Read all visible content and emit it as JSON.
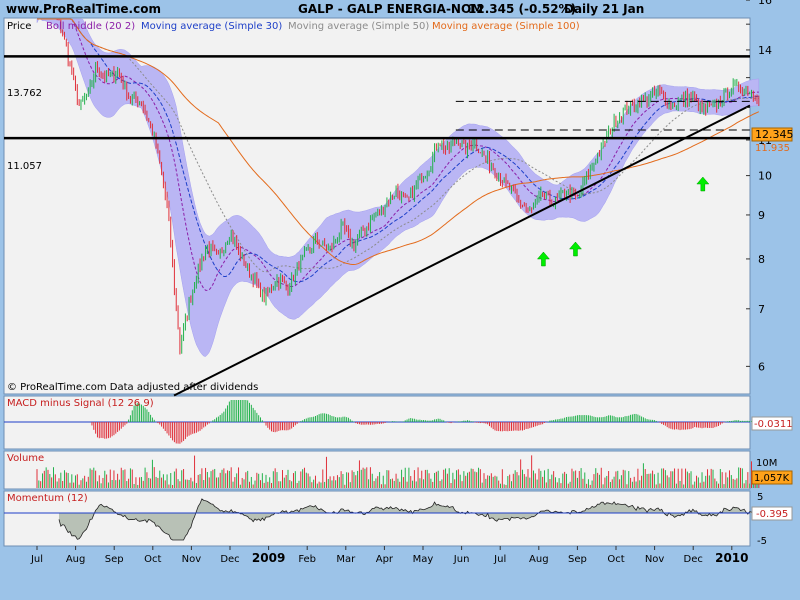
{
  "header": {
    "site": "www.ProRealTime.com",
    "instrument": "GALP - GALP ENERGIA-NOM",
    "quote": "12.345 (-0.52%)",
    "period": "Daily  21 Jan"
  },
  "price_panel": {
    "title": "Price",
    "legend": [
      {
        "label": "Boll middle (20 2)",
        "color": "#8b1fa8"
      },
      {
        "label": "Moving average (Simple 30)",
        "color": "#1d3fc8"
      },
      {
        "label": "Moving average (Simple 50)",
        "color": "#8c8c8c"
      },
      {
        "label": "Moving average (Simple 100)",
        "color": "#e36b1c"
      }
    ],
    "hline_labels": [
      "13.762",
      "11.057"
    ],
    "last_price": "12.345",
    "ma_value": "11.935",
    "footer": "© ProRealTime.com  Data adjusted after dividends"
  },
  "macd_panel": {
    "title": "MACD minus Signal (12 26 9)",
    "last_value": "-0.0311"
  },
  "volume_panel": {
    "title": "Volume",
    "top_tick": "10M",
    "last_value": "1,057K"
  },
  "momentum_panel": {
    "title": "Momentum (12)",
    "last_value": "-0.395",
    "ticks": [
      "5",
      "0",
      "-5"
    ]
  },
  "colors": {
    "background": "#9cc3e8",
    "panel": "#f2f2f2",
    "bollinger_band": "#bab6f4",
    "up_candle": "#22b14c",
    "down_candle": "#e0303a",
    "arrow": "#00ee00",
    "price_box": "#ffa21a"
  },
  "chart_data": {
    "type": "candlestick",
    "title": "GALP - GALP ENERGIA-NOM",
    "x_months": [
      "Jul",
      "Aug",
      "Sep",
      "Oct",
      "Nov",
      "Dec",
      "2009",
      "Feb",
      "Mar",
      "Apr",
      "May",
      "Jun",
      "Jul",
      "Aug",
      "Sep",
      "Oct",
      "Nov",
      "Dec",
      "2010"
    ],
    "y_ticks": [
      6,
      7,
      8,
      9,
      10,
      11,
      12,
      13,
      14,
      15,
      16
    ],
    "y_tick_labels": [
      "6",
      "7",
      "8",
      "9",
      "10",
      "11",
      "",
      "",
      "14",
      "",
      "16"
    ],
    "ylim": [
      5.6,
      16.4
    ],
    "horizontal_lines": [
      13.762,
      11.057
    ],
    "dashed_lines": [
      11.3,
      12.2
    ],
    "trendline": {
      "from": {
        "month": 3.55,
        "price": 5.55
      },
      "to": {
        "month": 19.0,
        "price": 12.0
      }
    },
    "arrows": [
      {
        "month": 13.12
      },
      {
        "month": 13.95
      },
      {
        "month": 17.25
      }
    ],
    "close_path": [
      [
        0.0,
        16.2
      ],
      [
        0.35,
        15.9
      ],
      [
        0.65,
        14.7
      ],
      [
        0.9,
        13.2
      ],
      [
        1.1,
        12.0
      ],
      [
        1.35,
        12.5
      ],
      [
        1.55,
        13.4
      ],
      [
        1.8,
        13.0
      ],
      [
        2.1,
        13.2
      ],
      [
        2.4,
        12.3
      ],
      [
        2.7,
        12.2
      ],
      [
        3.0,
        11.2
      ],
      [
        3.2,
        10.2
      ],
      [
        3.4,
        9.0
      ],
      [
        3.55,
        7.5
      ],
      [
        3.7,
        6.3
      ],
      [
        3.85,
        6.8
      ],
      [
        4.1,
        7.6
      ],
      [
        4.4,
        8.3
      ],
      [
        4.7,
        8.0
      ],
      [
        5.0,
        8.6
      ],
      [
        5.3,
        8.0
      ],
      [
        5.6,
        7.6
      ],
      [
        5.9,
        7.2
      ],
      [
        6.2,
        7.6
      ],
      [
        6.5,
        7.4
      ],
      [
        6.8,
        7.9
      ],
      [
        7.2,
        8.4
      ],
      [
        7.6,
        8.2
      ],
      [
        7.9,
        8.7
      ],
      [
        8.2,
        8.3
      ],
      [
        8.5,
        8.7
      ],
      [
        8.9,
        9.1
      ],
      [
        9.3,
        9.6
      ],
      [
        9.6,
        9.3
      ],
      [
        9.9,
        9.9
      ],
      [
        10.2,
        10.3
      ],
      [
        10.4,
        11.0
      ],
      [
        10.6,
        10.7
      ],
      [
        10.9,
        11.0
      ],
      [
        11.1,
        10.7
      ],
      [
        11.3,
        11.0
      ],
      [
        11.6,
        10.5
      ],
      [
        11.9,
        10.1
      ],
      [
        12.2,
        9.7
      ],
      [
        12.5,
        9.3
      ],
      [
        12.8,
        9.1
      ],
      [
        13.1,
        9.5
      ],
      [
        13.4,
        9.3
      ],
      [
        13.7,
        9.6
      ],
      [
        14.0,
        9.4
      ],
      [
        14.3,
        10.1
      ],
      [
        14.6,
        10.7
      ],
      [
        14.9,
        11.4
      ],
      [
        15.2,
        11.9
      ],
      [
        15.5,
        12.1
      ],
      [
        15.8,
        12.3
      ],
      [
        16.1,
        12.5
      ],
      [
        16.3,
        12.2
      ],
      [
        16.5,
        12.1
      ],
      [
        16.8,
        12.3
      ],
      [
        17.0,
        12.4
      ],
      [
        17.2,
        11.9
      ],
      [
        17.5,
        12.0
      ],
      [
        17.7,
        12.2
      ],
      [
        17.9,
        12.5
      ],
      [
        18.1,
        12.7
      ],
      [
        18.4,
        12.6
      ],
      [
        18.7,
        12.35
      ]
    ],
    "bollinger_half_width": [
      [
        0.0,
        0.9
      ],
      [
        1.0,
        1.1
      ],
      [
        2.0,
        1.1
      ],
      [
        2.7,
        0.7
      ],
      [
        3.2,
        1.5
      ],
      [
        3.6,
        1.9
      ],
      [
        4.2,
        1.3
      ],
      [
        5.0,
        0.8
      ],
      [
        6.0,
        0.5
      ],
      [
        7.5,
        0.8
      ],
      [
        9.0,
        0.5
      ],
      [
        10.3,
        0.8
      ],
      [
        11.5,
        0.6
      ],
      [
        12.5,
        0.7
      ],
      [
        13.5,
        0.4
      ],
      [
        14.5,
        0.8
      ],
      [
        15.5,
        0.7
      ],
      [
        16.5,
        0.4
      ],
      [
        17.5,
        0.4
      ],
      [
        18.7,
        0.45
      ]
    ]
  }
}
